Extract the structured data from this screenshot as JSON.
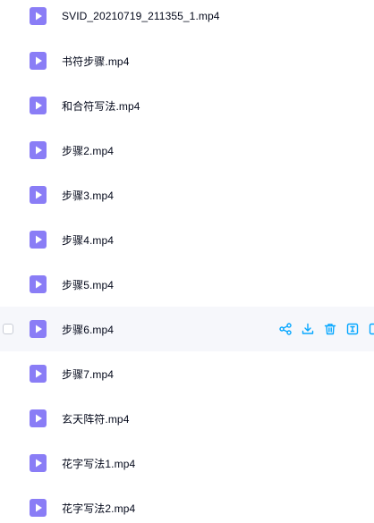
{
  "files": [
    {
      "name": "SVID_20210719_211355_1.mp4"
    },
    {
      "name": "书符步骤.mp4"
    },
    {
      "name": "和合符写法.mp4"
    },
    {
      "name": "步骤2.mp4"
    },
    {
      "name": "步骤3.mp4"
    },
    {
      "name": "步骤4.mp4"
    },
    {
      "name": "步骤5.mp4"
    },
    {
      "name": "步骤6.mp4"
    },
    {
      "name": "步骤7.mp4"
    },
    {
      "name": "玄天阵符.mp4"
    },
    {
      "name": "花字写法1.mp4"
    },
    {
      "name": "花字写法2.mp4"
    }
  ],
  "hovered_row_actions": [
    "share-icon",
    "download-icon",
    "delete-icon",
    "rename-icon",
    "more-icon"
  ],
  "colors": {
    "icon_purple": "#8a7df6",
    "action_blue": "#06a7ff",
    "hover_bg": "#f6f7fb"
  }
}
